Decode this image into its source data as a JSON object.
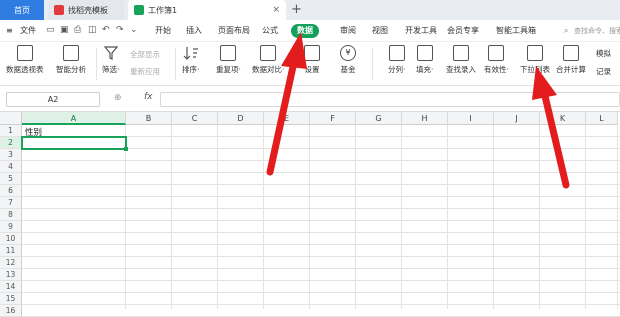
{
  "tabs": {
    "home": "首页",
    "template": "找稻壳模板",
    "workbook": "工作簿1",
    "close_glyph": "×",
    "new_glyph": "+"
  },
  "menu": {
    "file": "文件",
    "items": [
      "开始",
      "插入",
      "页面布局",
      "公式",
      "数据",
      "审阅",
      "视图",
      "开发工具",
      "会员专享",
      "智能工具箱"
    ],
    "active": "数据",
    "search_placeholder": "查找命令、搜索模板"
  },
  "ribbon": {
    "pivot": "数据透视表",
    "smart": "智能分析",
    "filter": "筛选·",
    "show_all": "全部显示",
    "reapply": "重新应用",
    "sort": "排序·",
    "duplicate": "重复项·",
    "compare": "数据对比·",
    "set": "设置",
    "fund": "基金",
    "split": "分列·",
    "fill": "填充·",
    "lookup": "查找录入",
    "validity": "有效性·",
    "dropdown": "下拉列表",
    "consolidate": "合并计算",
    "simulate": "模拟",
    "record": "记录"
  },
  "formula_bar": {
    "name_box": "A2",
    "fx": "fx",
    "value": ""
  },
  "sheet": {
    "columns": [
      "A",
      "B",
      "C",
      "D",
      "E",
      "F",
      "G",
      "H",
      "I",
      "J",
      "K",
      "L"
    ],
    "rows": [
      "1",
      "2",
      "3",
      "4",
      "5",
      "6",
      "7",
      "8",
      "9",
      "10",
      "11",
      "12",
      "13",
      "14",
      "15",
      "16"
    ],
    "cells": {
      "A1": "性别"
    },
    "active_cell": "A2"
  },
  "colors": {
    "accent": "#1aa35b",
    "arrow": "#e31d1d",
    "tab_home": "#2f7de1"
  }
}
